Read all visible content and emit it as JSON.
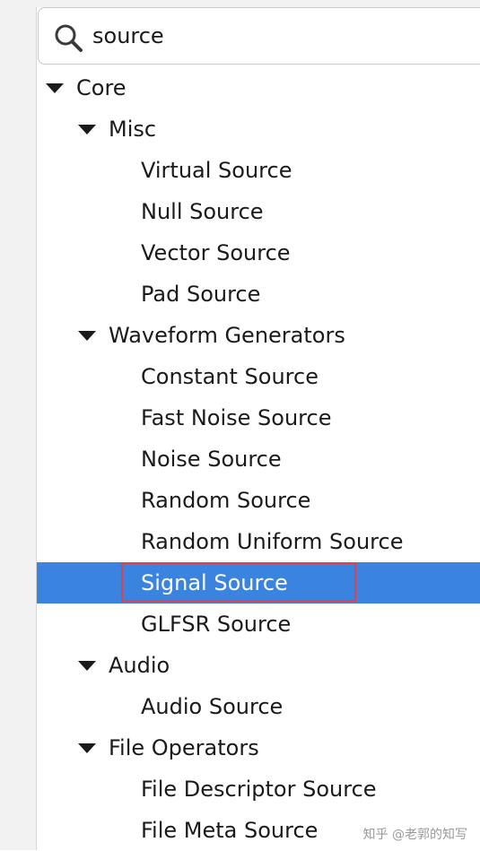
{
  "search": {
    "value": "source"
  },
  "tree": {
    "core": "Core",
    "misc": "Misc",
    "misc_items": [
      "Virtual Source",
      "Null Source",
      "Vector Source",
      "Pad Source"
    ],
    "waveform": "Waveform Generators",
    "waveform_items": [
      "Constant Source",
      "Fast Noise Source",
      "Noise Source",
      "Random Source",
      "Random Uniform Source",
      "Signal Source",
      "GLFSR Source"
    ],
    "audio": "Audio",
    "audio_items": [
      "Audio Source"
    ],
    "file_ops": "File Operators",
    "file_items": [
      "File Descriptor Source",
      "File Meta Source"
    ]
  },
  "colors": {
    "selection": "#3a84e0",
    "highlight_border": "#d9434f"
  },
  "watermark": "知乎 @老郭的知写"
}
